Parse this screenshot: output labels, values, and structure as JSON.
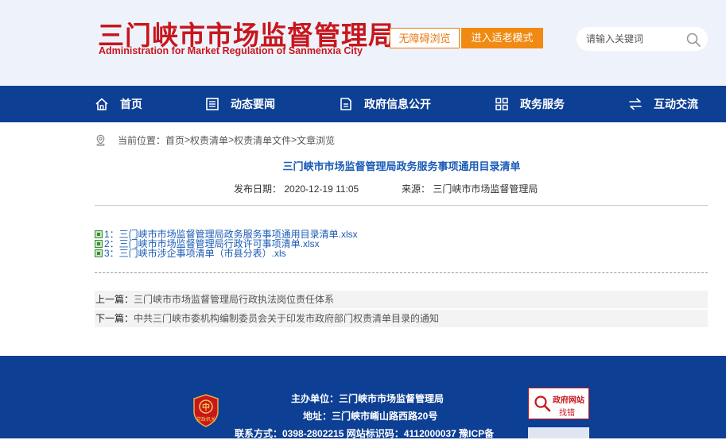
{
  "header": {
    "title_cn": "三门峡市市场监督管理局",
    "title_en": "Administration for Market Regulation of Sanmenxia City",
    "accessible_btn": "无障碍浏览",
    "elder_btn": "进入适老模式",
    "search_placeholder": "请输入关键词"
  },
  "nav": [
    {
      "label": "首页",
      "icon": "home-icon"
    },
    {
      "label": "动态要闻",
      "icon": "news-icon"
    },
    {
      "label": "政府信息公开",
      "icon": "document-icon"
    },
    {
      "label": "政务服务",
      "icon": "grid-icon"
    },
    {
      "label": "互动交流",
      "icon": "exchange-icon"
    }
  ],
  "breadcrumb": {
    "prefix": "当前位置：",
    "items": [
      "首页",
      "权责清单",
      "权责清单文件",
      "文章浏览"
    ],
    "sep": ">"
  },
  "article": {
    "title": "三门峡市市场监督管理局政务服务事项通用目录清单",
    "date_label": "发布日期：",
    "date": "2020-12-19 11:05",
    "source_label": "来源：",
    "source": "三门峡市市场监督管理局",
    "attachments": [
      "1：三门峡市市场监督管理局政务服务事项通用目录清单.xlsx",
      "2：三门峡市市场监督管理局行政许可事项清单.xlsx",
      "3：三门峡市涉企事项清单（市县分表）.xls"
    ]
  },
  "prev_next": {
    "prev_label": "上一篇：",
    "prev_title": "三门峡市市场监督管理局行政执法岗位责任体系",
    "next_label": "下一篇：",
    "next_title": "中共三门峡市委机构编制委员会关于印发市政府部门权责清单目录的通知"
  },
  "footer": {
    "host": "主办单位：三门峡市市场监督管理局",
    "address": "地址：三门峡市崤山路西路20号",
    "contact": "联系方式：0398-2802215   网站标识码：4112000037   豫ICP备",
    "emblem_text": "党政机关",
    "badge_title": "政府网站",
    "badge_sub": "找错"
  },
  "colors": {
    "brand_red": "#c8161d",
    "nav_blue": "#0d3f94",
    "link_blue": "#1a5bb5",
    "accent_orange": "#f08a12"
  }
}
